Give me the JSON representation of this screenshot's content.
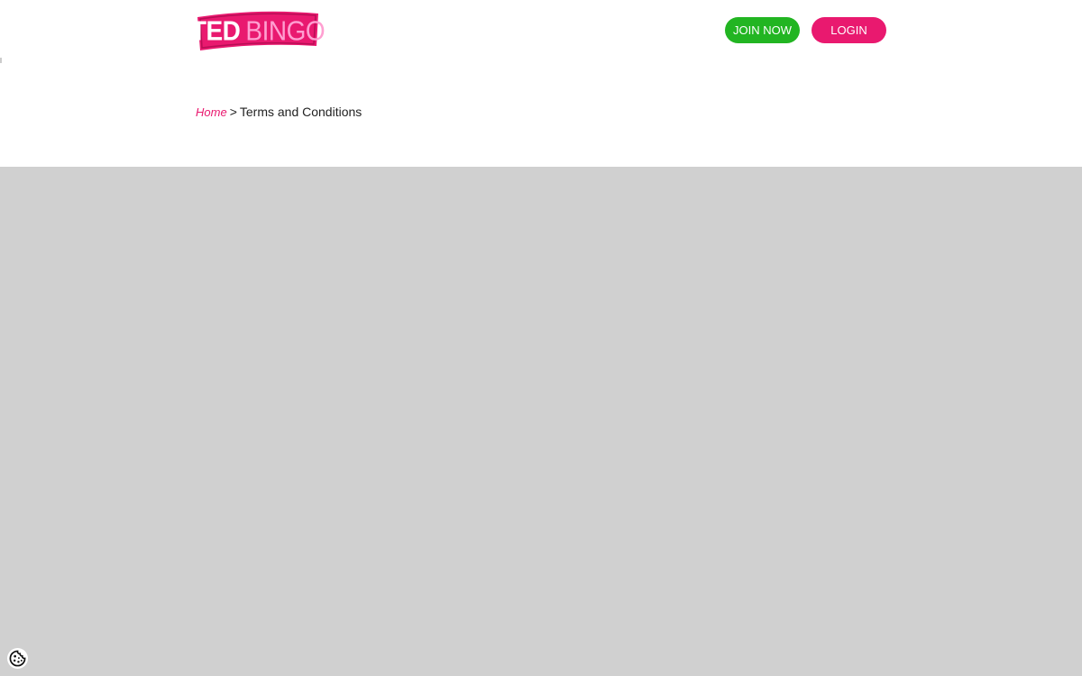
{
  "header": {
    "logo": {
      "word1": "TED",
      "word2": "BINGO",
      "icon": "ted-bingo-logo"
    },
    "join_label": "JOIN NOW",
    "login_label": "LOGIN"
  },
  "breadcrumb": {
    "home_label": "Home",
    "separator": ">",
    "current_label": "Terms and Conditions"
  },
  "cookie": {
    "icon": "cookie-icon"
  },
  "colors": {
    "brand_pink": "#e9196f",
    "join_green": "#22b522",
    "content_gray": "#d0d0d0"
  }
}
